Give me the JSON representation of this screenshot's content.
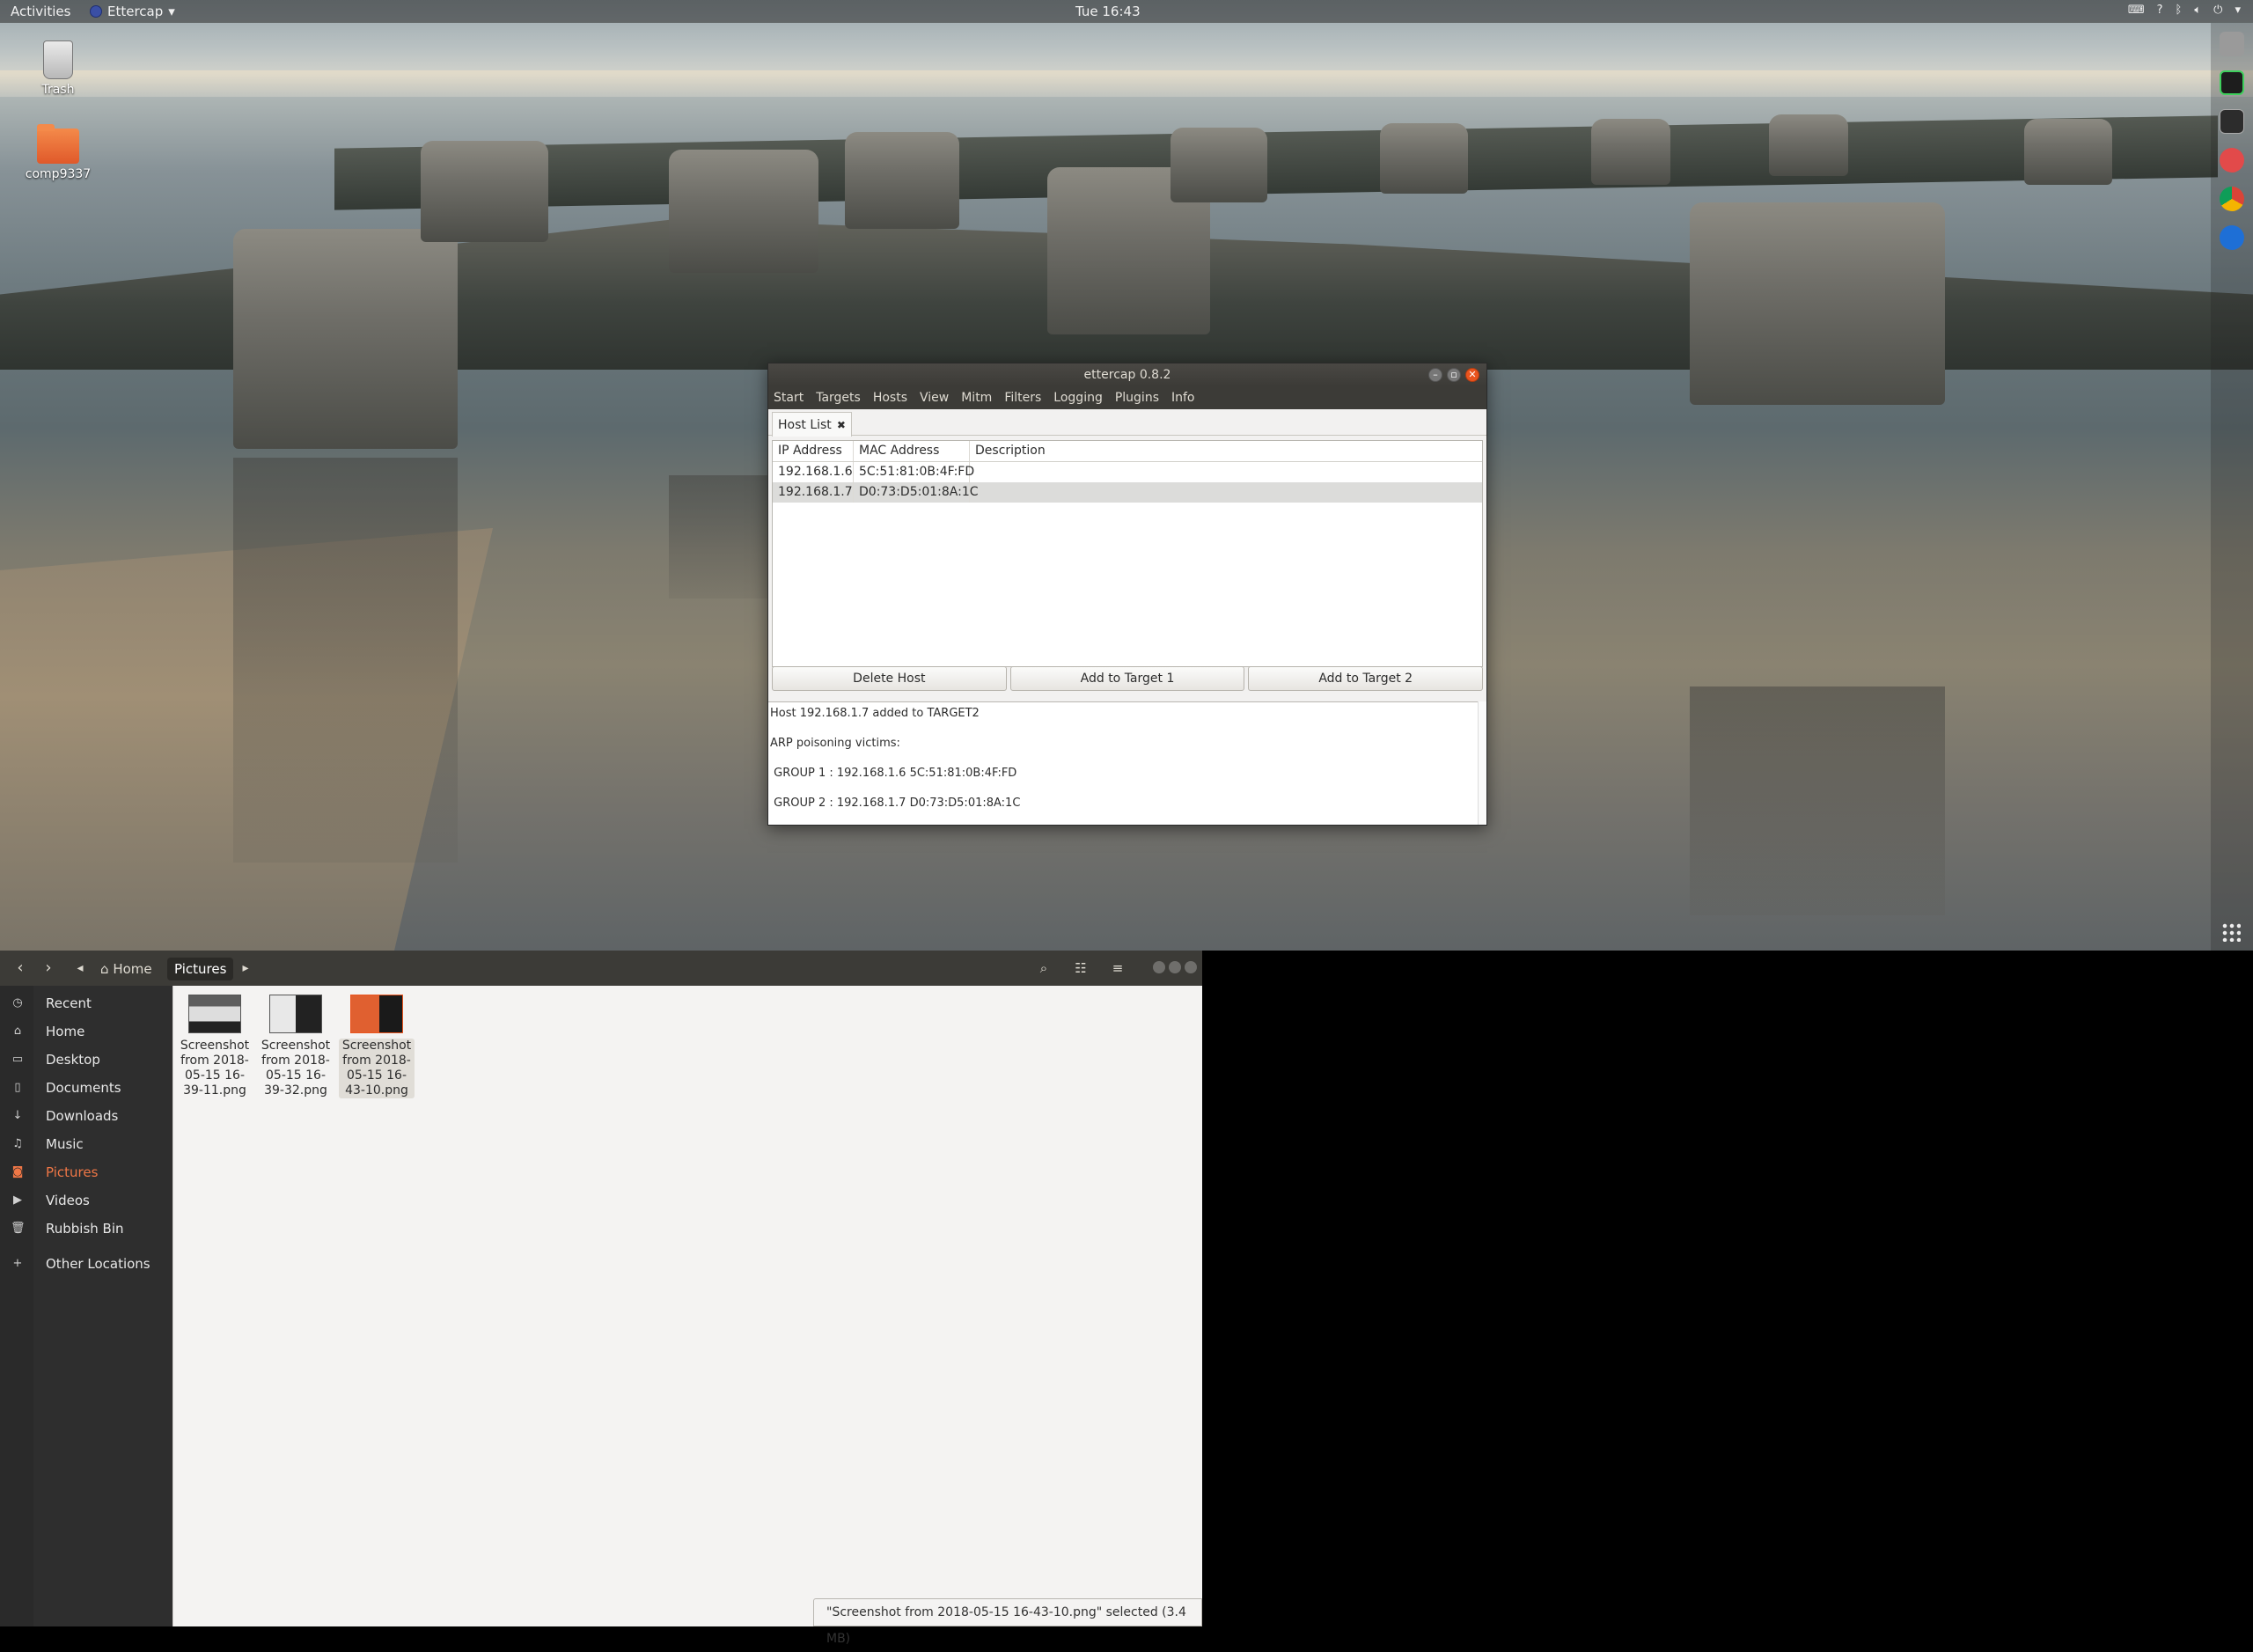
{
  "topbar": {
    "activities": "Activities",
    "app_name": "Ettercap",
    "clock": "Tue 16:43"
  },
  "desktop": {
    "icons": [
      {
        "label": "Trash"
      },
      {
        "label": "comp9337"
      }
    ]
  },
  "ettercap": {
    "title": "ettercap 0.8.2",
    "menu": [
      "Start",
      "Targets",
      "Hosts",
      "View",
      "Mitm",
      "Filters",
      "Logging",
      "Plugins",
      "Info"
    ],
    "tab_label": "Host List",
    "columns": [
      "IP Address",
      "MAC Address",
      "Description"
    ],
    "rows": [
      {
        "ip": "192.168.1.6",
        "mac": "5C:51:81:0B:4F:FD",
        "description": ""
      },
      {
        "ip": "192.168.1.7",
        "mac": "D0:73:D5:01:8A:1C",
        "description": ""
      }
    ],
    "buttons": {
      "delete": "Delete Host",
      "target1": "Add to Target 1",
      "target2": "Add to Target 2"
    },
    "log": [
      "Host 192.168.1.7 added to TARGET2",
      "ARP poisoning victims:",
      " GROUP 1 : 192.168.1.6 5C:51:81:0B:4F:FD",
      " GROUP 2 : 192.168.1.7 D0:73:D5:01:8A:1C"
    ]
  },
  "files": {
    "breadcrumb": {
      "home": "Home",
      "current": "Pictures"
    },
    "sidebar": [
      {
        "label": "Recent",
        "icon": "clock-icon"
      },
      {
        "label": "Home",
        "icon": "home-icon"
      },
      {
        "label": "Desktop",
        "icon": "folder-icon"
      },
      {
        "label": "Documents",
        "icon": "document-icon"
      },
      {
        "label": "Downloads",
        "icon": "download-icon"
      },
      {
        "label": "Music",
        "icon": "music-icon"
      },
      {
        "label": "Pictures",
        "icon": "camera-icon"
      },
      {
        "label": "Videos",
        "icon": "video-icon"
      },
      {
        "label": "Rubbish Bin",
        "icon": "trash-icon"
      },
      {
        "label": "Other Locations",
        "icon": "plus-icon"
      }
    ],
    "active_sidebar": "Pictures",
    "items": [
      {
        "name": "Screenshot from 2018-05-15 16-39-11.png"
      },
      {
        "name": "Screenshot from 2018-05-15 16-39-32.png"
      },
      {
        "name": "Screenshot from 2018-05-15 16-43-10.png"
      }
    ],
    "status": "\"Screenshot from 2018-05-15 16-43-10.png\" selected  (3.4 MB)"
  },
  "colors": {
    "accent": "#f07746",
    "ubuntu_orange": "#e9541e",
    "dark_header": "#3c3b37"
  }
}
